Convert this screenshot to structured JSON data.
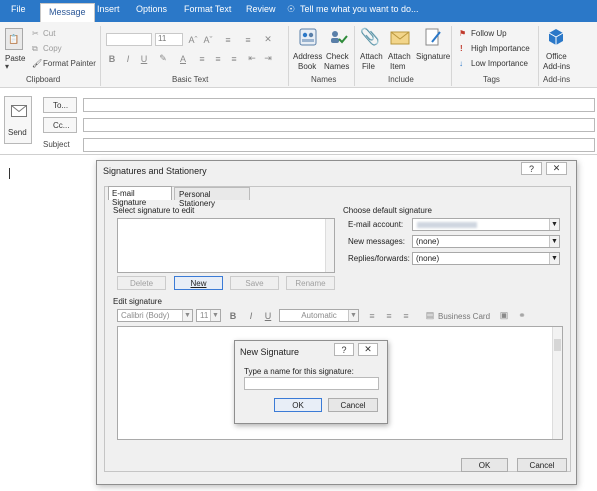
{
  "tabs": [
    "File",
    "Message",
    "Insert",
    "Options",
    "Format Text",
    "Review"
  ],
  "tell_me": "Tell me what you want to do...",
  "ribbon": {
    "paste": "Paste",
    "cut": "Cut",
    "copy": "Copy",
    "format_painter": "Format Painter",
    "font_size": "11",
    "group_clipboard": "Clipboard",
    "group_basic_text": "Basic Text",
    "address_book": [
      "Address",
      "Book"
    ],
    "check_names": [
      "Check",
      "Names"
    ],
    "group_names": "Names",
    "attach_file": [
      "Attach",
      "File"
    ],
    "attach_item": [
      "Attach",
      "Item"
    ],
    "signature": "Signature",
    "group_include": "Include",
    "follow_up": "Follow Up",
    "high_importance": "High Importance",
    "low_importance": "Low Importance",
    "group_tags": "Tags",
    "office_addins": [
      "Office",
      "Add-ins"
    ],
    "group_addins": "Add-ins"
  },
  "compose": {
    "send": "Send",
    "to": "To...",
    "cc": "Cc...",
    "subject": "Subject"
  },
  "dialog": {
    "title": "Signatures and Stationery",
    "help": "?",
    "close": "✕",
    "tab_email": "E-mail Signature",
    "tab_personal": "Personal Stationery",
    "select_label": "Select signature to edit",
    "choose_default": "Choose default signature",
    "email_account_label": "E-mail account:",
    "email_account_value": "",
    "new_messages_label": "New messages:",
    "new_messages_value": "(none)",
    "replies_label": "Replies/forwards:",
    "replies_value": "(none)",
    "btn_delete": "Delete",
    "btn_new": "New",
    "btn_save": "Save",
    "btn_rename": "Rename",
    "edit_label": "Edit signature",
    "font_name": "Calibri (Body)",
    "font_size": "11",
    "color": "Automatic",
    "business_card": "Business Card",
    "ok": "OK",
    "cancel": "Cancel"
  },
  "new_sig": {
    "title": "New Signature",
    "help": "?",
    "close": "✕",
    "prompt": "Type a name for this signature:",
    "value": "",
    "ok": "OK",
    "cancel": "Cancel"
  },
  "colors": {
    "accent": "#2b78c8",
    "ribbon_bg": "#f4f4f4",
    "dialog_bg": "#f0f0f0"
  }
}
